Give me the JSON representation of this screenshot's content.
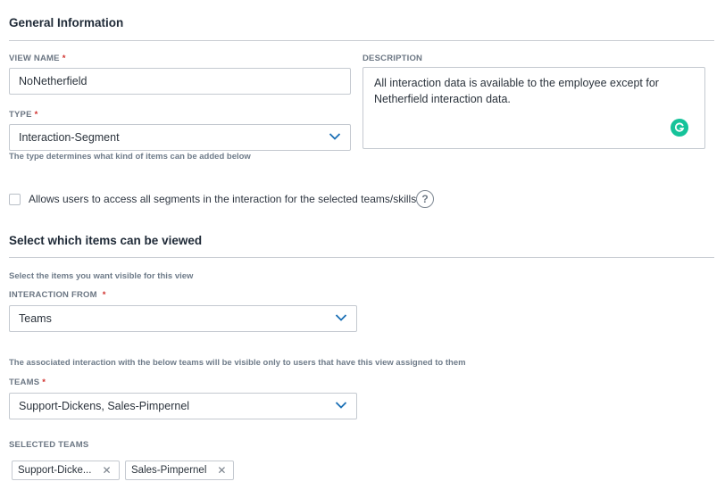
{
  "general": {
    "title": "General Information",
    "view_name_label": "VIEW NAME",
    "required_mark": "*",
    "view_name_value": "NoNetherfield",
    "type_label": "TYPE",
    "type_value": "Interaction-Segment",
    "type_hint": "The type determines what kind of items can be added below",
    "description_label": "DESCRIPTION",
    "description_value": "All interaction data is available to the employee except for Netherfield interaction data.",
    "allow_all_segments_label": "Allows users to access all segments in the interaction for the selected teams/skills",
    "allow_all_segments_checked": false,
    "help_glyph": "?"
  },
  "items": {
    "title": "Select which items can be viewed",
    "instruction": "Select the items you want visible for this view",
    "interaction_from_label": "INTERACTION FROM",
    "interaction_from_value": "Teams",
    "teams_hint": "The associated interaction with the below teams will be visible only to users that have this view assigned to them",
    "teams_label": "TEAMS",
    "teams_value": "Support-Dickens, Sales-Pimpernel",
    "selected_teams_label": "SELECTED TEAMS",
    "selected_teams": [
      {
        "label": "Support-Dicke..."
      },
      {
        "label": "Sales-Pimpernel"
      }
    ],
    "remove_glyph": "✕"
  },
  "colors": {
    "required": "#d0312d",
    "chevron": "#1a6fb5",
    "grammarly": "#15c39a"
  },
  "icons": {
    "dropdown": "chevron-down-icon",
    "help": "question-circle-icon",
    "grammarly": "grammarly-icon",
    "remove": "close-icon"
  }
}
